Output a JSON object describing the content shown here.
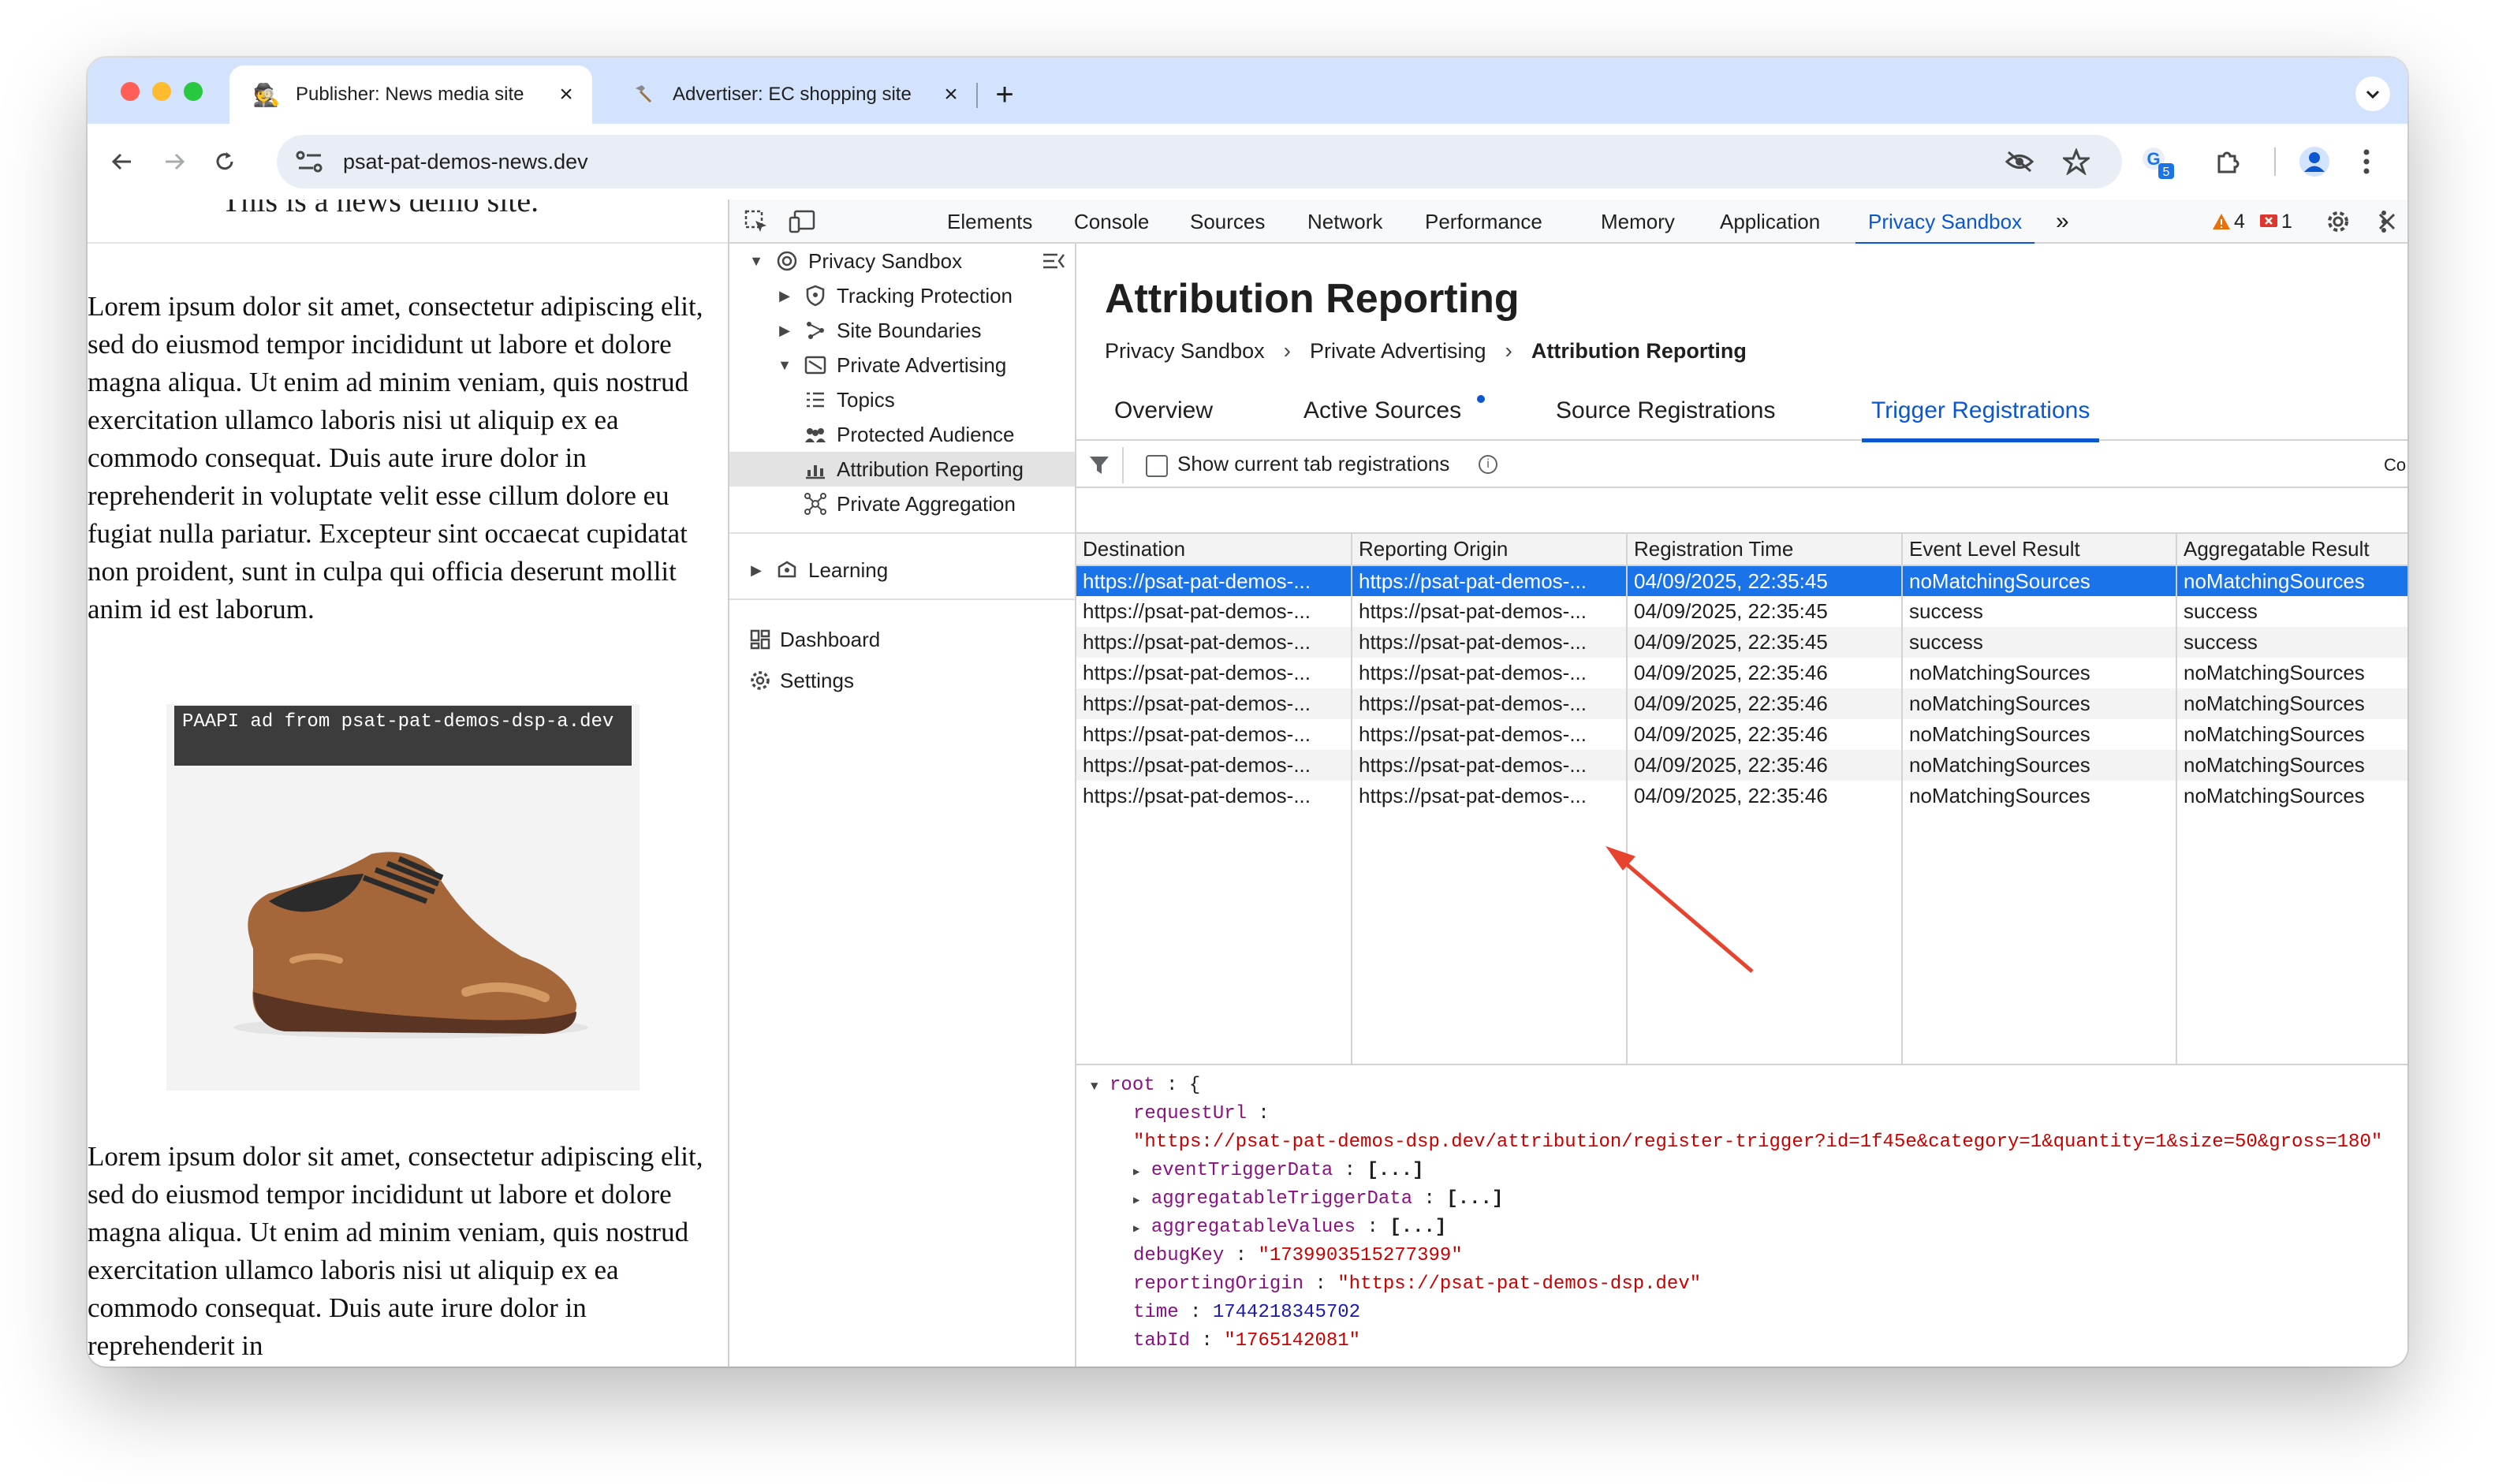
{
  "browser": {
    "tabs": [
      {
        "title": "Publisher: News media site",
        "active": true,
        "favicon": "spy-emoji-icon"
      },
      {
        "title": "Advertiser: EC shopping site",
        "active": false,
        "favicon": "hammer-icon"
      }
    ],
    "new_tab": "+",
    "url": "psat-pat-demos-news.dev",
    "extension_badge": "5"
  },
  "page": {
    "heading_partial": "This is a news demo site.",
    "paragraph1": "Lorem ipsum dolor sit amet, consectetur adipiscing elit, sed do eiusmod tempor incididunt ut labore et dolore magna aliqua. Ut enim ad minim veniam, quis nostrud exercitation ullamco laboris nisi ut aliquip ex ea commodo consequat. Duis aute irure dolor in reprehenderit in voluptate velit esse cillum dolore eu fugiat nulla pariatur. Excepteur sint occaecat cupidatat non proident, sunt in culpa qui officia deserunt mollit anim id est laborum.",
    "ad_label": "PAAPI ad from psat-pat-demos-dsp-a.dev",
    "paragraph2": "Lorem ipsum dolor sit amet, consectetur adipiscing elit, sed do eiusmod tempor incididunt ut labore et dolore magna aliqua. Ut enim ad minim veniam, quis nostrud exercitation ullamco laboris nisi ut aliquip ex ea commodo consequat. Duis aute irure dolor in reprehenderit in"
  },
  "devtools": {
    "tabs": [
      "Elements",
      "Console",
      "Sources",
      "Network",
      "Performance",
      "Memory",
      "Application",
      "Privacy Sandbox"
    ],
    "selected_tab": "Privacy Sandbox",
    "more": "»",
    "warnings": "4",
    "errors": "1",
    "sidebar": {
      "root": "Privacy Sandbox",
      "items": [
        "Tracking Protection",
        "Site Boundaries",
        "Private Advertising",
        "Topics",
        "Protected Audience",
        "Attribution Reporting",
        "Private Aggregation",
        "Learning",
        "Dashboard",
        "Settings"
      ],
      "selected": "Attribution Reporting"
    },
    "panel": {
      "title": "Attribution Reporting",
      "breadcrumb": [
        "Privacy Sandbox",
        "Private Advertising",
        "Attribution Reporting"
      ],
      "subtabs": [
        "Overview",
        "Active Sources",
        "Source Registrations",
        "Trigger Registrations"
      ],
      "selected_subtab": "Trigger Registrations",
      "checkbox_label": "Show current tab registrations",
      "cut_text": "Co",
      "table": {
        "columns": [
          "Destination",
          "Reporting Origin",
          "Registration Time",
          "Event Level Result",
          "Aggregatable Result"
        ],
        "rows": [
          [
            "https://psat-pat-demos-...",
            "https://psat-pat-demos-...",
            "04/09/2025, 22:35:45",
            "noMatchingSources",
            "noMatchingSources"
          ],
          [
            "https://psat-pat-demos-...",
            "https://psat-pat-demos-...",
            "04/09/2025, 22:35:45",
            "success",
            "success"
          ],
          [
            "https://psat-pat-demos-...",
            "https://psat-pat-demos-...",
            "04/09/2025, 22:35:45",
            "success",
            "success"
          ],
          [
            "https://psat-pat-demos-...",
            "https://psat-pat-demos-...",
            "04/09/2025, 22:35:46",
            "noMatchingSources",
            "noMatchingSources"
          ],
          [
            "https://psat-pat-demos-...",
            "https://psat-pat-demos-...",
            "04/09/2025, 22:35:46",
            "noMatchingSources",
            "noMatchingSources"
          ],
          [
            "https://psat-pat-demos-...",
            "https://psat-pat-demos-...",
            "04/09/2025, 22:35:46",
            "noMatchingSources",
            "noMatchingSources"
          ],
          [
            "https://psat-pat-demos-...",
            "https://psat-pat-demos-...",
            "04/09/2025, 22:35:46",
            "noMatchingSources",
            "noMatchingSources"
          ],
          [
            "https://psat-pat-demos-...",
            "https://psat-pat-demos-...",
            "04/09/2025, 22:35:46",
            "noMatchingSources",
            "noMatchingSources"
          ]
        ]
      },
      "json": {
        "root_key": "root",
        "request_url_key": "requestUrl",
        "request_url": "\"https://psat-pat-demos-dsp.dev/attribution/register-trigger?id=1f45e&category=1&quantity=1&size=50&gross=180\"",
        "event_trigger_key": "eventTriggerData",
        "aggregatable_trigger_key": "aggregatableTriggerData",
        "aggregatable_values_key": "aggregatableValues",
        "collapsed": "[...]",
        "debug_key_key": "debugKey",
        "debug_key": "\"1739903515277399\"",
        "reporting_origin_key": "reportingOrigin",
        "reporting_origin": "\"https://psat-pat-demos-dsp.dev\"",
        "time_key": "time",
        "time": "1744218345702",
        "tab_id_key": "tabId",
        "tab_id": "\"1765142081\""
      }
    }
  },
  "colors": {
    "accent": "#0b57d0",
    "selected_row": "#1a73e8",
    "annotation_arrow": "#e8432e"
  }
}
